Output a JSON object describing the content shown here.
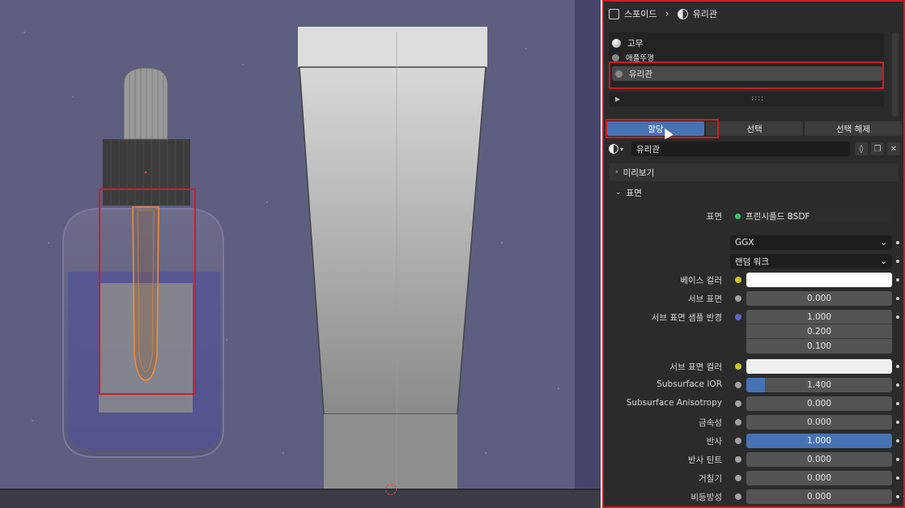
{
  "viewport": {},
  "panel": {
    "breadcrumb": {
      "object": "스포이드",
      "material": "유리관"
    },
    "slots": [
      {
        "label": "고무"
      },
      {
        "label": "애플뚜껑"
      },
      {
        "label": "유리관"
      }
    ],
    "buttons": {
      "assign": "할당",
      "select": "선택",
      "deselect": "선택 해제"
    },
    "material_name": "유리관",
    "sections": {
      "preview": "미리보기",
      "surface": "표면"
    },
    "props": {
      "surface": {
        "label": "표면",
        "value": "프린시플드 BSDF"
      },
      "distribution": {
        "value": "GGX"
      },
      "subsurface_method": {
        "value": "랜덤 워크"
      },
      "base_color": {
        "label": "베이스 컬러",
        "color": "#ffffff"
      },
      "subsurface": {
        "label": "서브 표면",
        "value": "0.000"
      },
      "subsurface_radius": {
        "label": "서브 표면 샘플 반경",
        "values": [
          "1.000",
          "0.200",
          "0.100"
        ]
      },
      "subsurface_color": {
        "label": "서브 표면 컬러",
        "color": "#efefef"
      },
      "subsurface_ior": {
        "label": "Subsurface IOR",
        "value": "1.400",
        "fill": 0.13
      },
      "subsurface_aniso": {
        "label": "Subsurface Anisotropy",
        "value": "0.000"
      },
      "metallic": {
        "label": "금속성",
        "value": "0.000"
      },
      "specular": {
        "label": "반사",
        "value": "1.000"
      },
      "specular_tint": {
        "label": "반사 틴트",
        "value": "0.000"
      },
      "roughness": {
        "label": "거칠기",
        "value": "0.000"
      },
      "anisotropic": {
        "label": "비등방성",
        "value": "0.000"
      }
    }
  },
  "colors": {
    "accent": "#4772b3",
    "highlight": "#d01c24",
    "panel_bg": "#2b2b2b"
  }
}
